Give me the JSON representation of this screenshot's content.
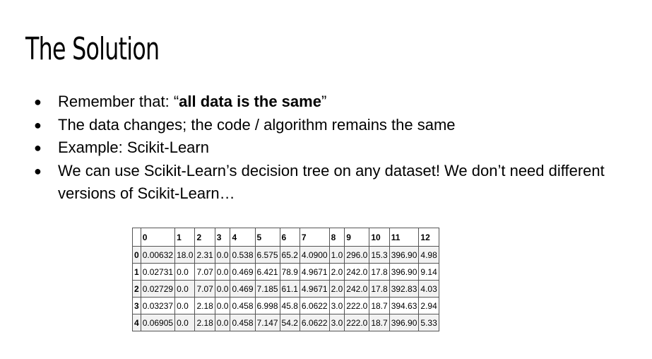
{
  "slide": {
    "title": "The Solution",
    "bullets": [
      {
        "parts": [
          "Remember that: “",
          "all data is the same",
          "”"
        ]
      },
      {
        "text": "The data changes; the code / algorithm remains the same"
      },
      {
        "text": "Example: Scikit-Learn"
      },
      {
        "text": "We can use Scikit-Learn’s decision tree on any dataset! We don’t need different versions of Scikit-Learn…"
      }
    ],
    "bullet_glyph": "●"
  },
  "table": {
    "columns": [
      "",
      "0",
      "1",
      "2",
      "3",
      "4",
      "5",
      "6",
      "7",
      "8",
      "9",
      "10",
      "11",
      "12"
    ],
    "rows": [
      [
        "0",
        "0.00632",
        "18.0",
        "2.31",
        "0.0",
        "0.538",
        "6.575",
        "65.2",
        "4.0900",
        "1.0",
        "296.0",
        "15.3",
        "396.90",
        "4.98"
      ],
      [
        "1",
        "0.02731",
        "0.0",
        "7.07",
        "0.0",
        "0.469",
        "6.421",
        "78.9",
        "4.9671",
        "2.0",
        "242.0",
        "17.8",
        "396.90",
        "9.14"
      ],
      [
        "2",
        "0.02729",
        "0.0",
        "7.07",
        "0.0",
        "0.469",
        "7.185",
        "61.1",
        "4.9671",
        "2.0",
        "242.0",
        "17.8",
        "392.83",
        "4.03"
      ],
      [
        "3",
        "0.03237",
        "0.0",
        "2.18",
        "0.0",
        "0.458",
        "6.998",
        "45.8",
        "6.0622",
        "3.0",
        "222.0",
        "18.7",
        "394.63",
        "2.94"
      ],
      [
        "4",
        "0.06905",
        "0.0",
        "2.18",
        "0.0",
        "0.458",
        "7.147",
        "54.2",
        "6.0622",
        "3.0",
        "222.0",
        "18.7",
        "396.90",
        "5.33"
      ]
    ]
  }
}
